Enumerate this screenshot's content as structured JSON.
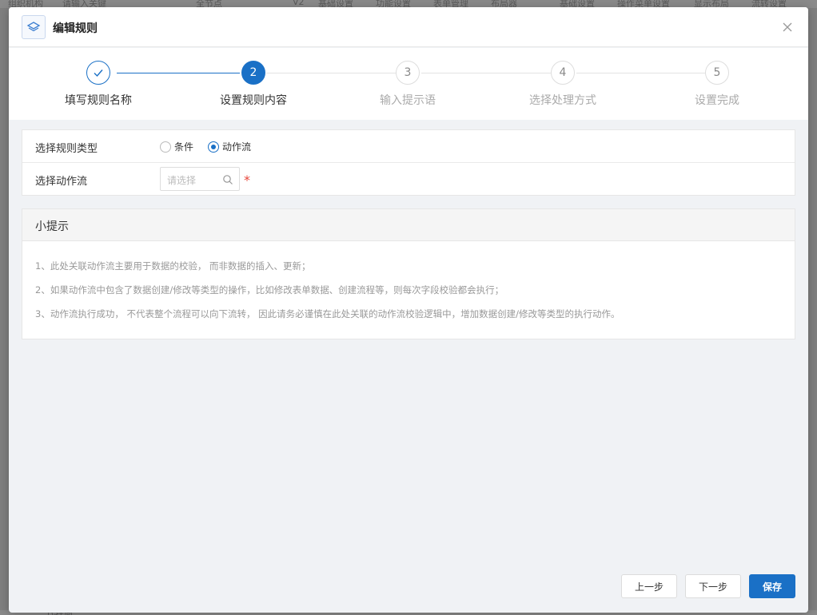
{
  "background": {
    "top_labels": [
      "组织机构",
      "请输入关键",
      "全节点",
      "V2",
      "基础设置",
      "功能设置",
      "表单管理",
      "布局器",
      "基础设置",
      "操作菜单设置",
      "显示布局",
      "流转设置"
    ],
    "bottom_label": "代理商"
  },
  "dialog": {
    "title": "编辑规则",
    "logo_icon": "layers-icon",
    "close_icon": "close-icon"
  },
  "steps": [
    {
      "index": "1",
      "label": "填写规则名称",
      "state": "done"
    },
    {
      "index": "2",
      "label": "设置规则内容",
      "state": "active"
    },
    {
      "index": "3",
      "label": "输入提示语",
      "state": "pending"
    },
    {
      "index": "4",
      "label": "选择处理方式",
      "state": "pending"
    },
    {
      "index": "5",
      "label": "设置完成",
      "state": "pending"
    }
  ],
  "form": {
    "rule_type": {
      "label": "选择规则类型",
      "options": [
        "条件",
        "动作流"
      ],
      "selected": "动作流"
    },
    "action_flow": {
      "label": "选择动作流",
      "placeholder": "请选择",
      "value": "",
      "required_mark": "*"
    }
  },
  "tips": {
    "title": "小提示",
    "items": [
      "1、此处关联动作流主要用于数据的校验， 而非数据的插入、更新；",
      "2、如果动作流中包含了数据创建/修改等类型的操作，比如修改表单数据、创建流程等，则每次字段校验都会执行；",
      "3、动作流执行成功， 不代表整个流程可以向下流转， 因此请务必谨慎在此处关联的动作流校验逻辑中，增加数据创建/修改等类型的执行动作。"
    ]
  },
  "footer": {
    "prev_label": "上一步",
    "next_label": "下一步",
    "save_label": "保存"
  },
  "colors": {
    "primary": "#1a70c6",
    "required": "#e8473b"
  }
}
